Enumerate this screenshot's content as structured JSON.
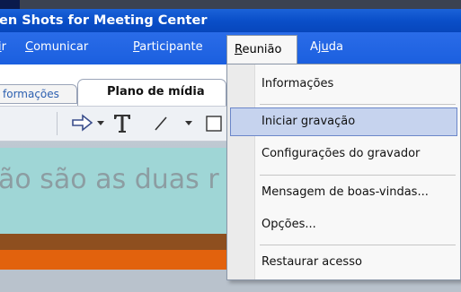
{
  "window": {
    "title": "en Shots for Meeting Center"
  },
  "menubar": {
    "items": [
      {
        "key": "i",
        "label": "ir"
      },
      {
        "key": "C",
        "label": "Comunicar"
      },
      {
        "key": "P",
        "label": "Participante"
      },
      {
        "key": "R",
        "label": "Reunião"
      },
      {
        "key": "u",
        "label": "Ajuda"
      }
    ]
  },
  "tabs": {
    "info_label": "formações",
    "plano_label": "Plano de mídia"
  },
  "content": {
    "slide_text": "ão são as duas r"
  },
  "dropdown": {
    "items": [
      {
        "label": "Informações"
      },
      {
        "label": "Iniciar gravação"
      },
      {
        "label": "Configurações do gravador"
      },
      {
        "label": "Mensagem de boas-vindas..."
      },
      {
        "label": "Opções..."
      },
      {
        "label": "Restaurar acesso"
      }
    ]
  },
  "colors": {
    "titlebar": "#0a4fc9",
    "menubar": "#1b5fdf",
    "highlight": "#c6d3ee",
    "orange": "#e2620d"
  }
}
